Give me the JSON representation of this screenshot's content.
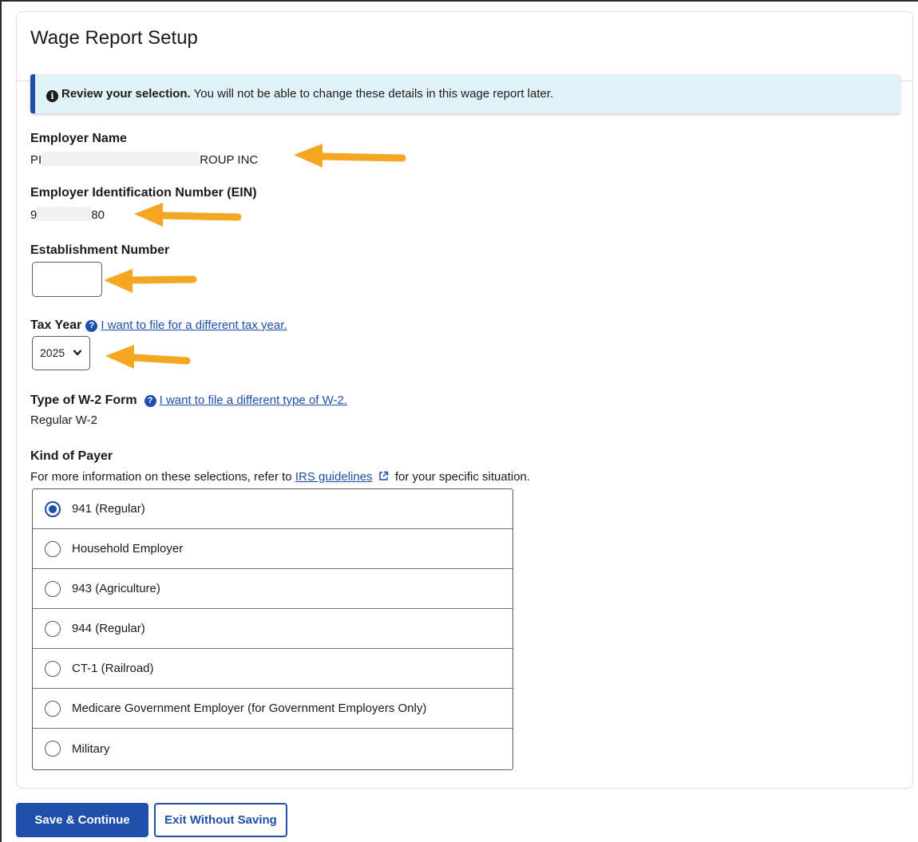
{
  "card": {
    "title": "Wage Report Setup"
  },
  "alert": {
    "strong": "Review your selection.",
    "text": " You will not be able to change these details in this wage report later."
  },
  "employer_name": {
    "label": "Employer Name",
    "prefix": "PI",
    "suffix": "ROUP INC"
  },
  "ein": {
    "label": "Employer Identification Number (EIN)",
    "prefix": "9",
    "suffix": "80"
  },
  "establishment": {
    "label": "Establishment Number",
    "value": ""
  },
  "tax_year": {
    "label": "Tax Year",
    "link": "I want to file for a different tax year.",
    "selected": "2025"
  },
  "w2_type": {
    "label": "Type of W-2 Form",
    "link": "I want to file a different type of W-2.",
    "value": "Regular W-2"
  },
  "kind_of_payer": {
    "label": "Kind of Payer",
    "note_before": "For more information on these selections, refer to ",
    "note_link": "IRS guidelines",
    "note_after": " for your specific situation.",
    "options": [
      {
        "label": "941 (Regular)",
        "checked": true
      },
      {
        "label": "Household Employer",
        "checked": false
      },
      {
        "label": "943 (Agriculture)",
        "checked": false
      },
      {
        "label": "944 (Regular)",
        "checked": false
      },
      {
        "label": "CT-1 (Railroad)",
        "checked": false
      },
      {
        "label": "Medicare Government Employer (for Government Employers Only)",
        "checked": false
      },
      {
        "label": "Military",
        "checked": false
      }
    ]
  },
  "buttons": {
    "save": "Save & Continue",
    "exit": "Exit Without Saving"
  },
  "colors": {
    "primary": "#1f4fa8",
    "alert_bg": "#e1f3f8",
    "annotation_arrow": "#f5a623"
  }
}
